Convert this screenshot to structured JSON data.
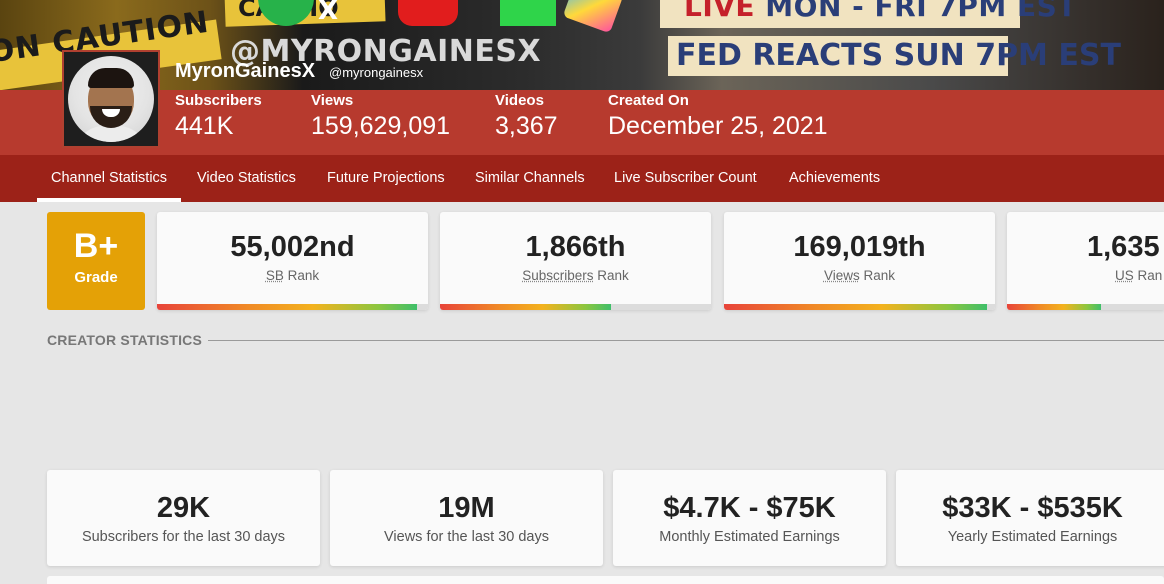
{
  "banner": {
    "tape_text": "ON  CAUTION",
    "tape_text2": "CAUTIO",
    "x_text": "X",
    "handle_text": "@MYRONGAINESX",
    "live_prefix": "LIVE",
    "live_rest": " MON - FRI 7PM EST",
    "fed_text": "FED REACTS SUN 7PM EST"
  },
  "channel": {
    "name": "MyronGainesX",
    "handle": "@myrongainesx"
  },
  "header_stats": [
    {
      "label": "Subscribers",
      "value": "441K"
    },
    {
      "label": "Views",
      "value": "159,629,091"
    },
    {
      "label": "Videos",
      "value": "3,367"
    },
    {
      "label": "Created On",
      "value": "December 25, 2021"
    }
  ],
  "tabs": [
    {
      "label": "Channel Statistics",
      "active": true
    },
    {
      "label": "Video Statistics"
    },
    {
      "label": "Future Projections"
    },
    {
      "label": "Similar Channels"
    },
    {
      "label": "Live Subscriber Count"
    },
    {
      "label": "Achievements"
    }
  ],
  "grade": {
    "value": "B+",
    "label": "Grade",
    "color": "#e4a106"
  },
  "ranks": [
    {
      "value": "55,002nd",
      "label_key": "SB",
      "label_rest": " Rank",
      "progress": 0.96
    },
    {
      "value": "1,866th",
      "label_key": "Subscribers",
      "label_rest": " Rank",
      "progress": 0.63
    },
    {
      "value": "169,019th",
      "label_key": "Views",
      "label_rest": " Rank",
      "progress": 0.97
    },
    {
      "value": "1,635",
      "label_key": "US",
      "label_rest": " Ran",
      "progress": 0.6
    }
  ],
  "section": {
    "title": "CREATOR STATISTICS"
  },
  "creator_stats": [
    {
      "value": "29K",
      "label": "Subscribers for the last 30 days"
    },
    {
      "value": "19M",
      "label": "Views for the last 30 days"
    },
    {
      "value": "$4.7K - $75K",
      "label": "Monthly Estimated Earnings"
    },
    {
      "value": "$33K - $535K",
      "label": "Yearly Estimated Earnings"
    }
  ],
  "colors": {
    "header_band": "#b73a2e",
    "tabs_bar": "#9c2218",
    "page_bg": "#e6e6e6",
    "grade": "#e4a106"
  }
}
